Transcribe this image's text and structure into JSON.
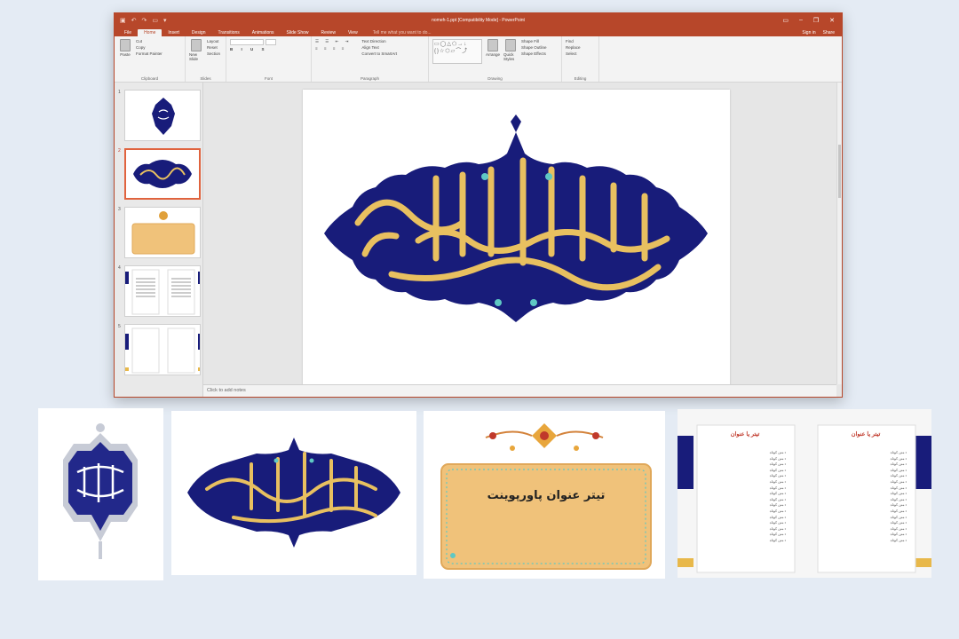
{
  "window": {
    "title": "nomeh-1.ppt [Compatibility Mode] - PowerPoint",
    "tabs": [
      "File",
      "Home",
      "Insert",
      "Design",
      "Transitions",
      "Animations",
      "Slide Show",
      "Review",
      "View"
    ],
    "active_tab": "Home",
    "tell_me": "Tell me what you want to do...",
    "sign_in": "Sign in",
    "share": "Share"
  },
  "ribbon": {
    "clipboard": {
      "label": "Clipboard",
      "paste": "Paste",
      "cut": "Cut",
      "copy": "Copy",
      "format_painter": "Format Painter"
    },
    "slides": {
      "label": "Slides",
      "new_slide": "New Slide",
      "layout": "Layout",
      "reset": "Reset",
      "section": "Section"
    },
    "font": {
      "label": "Font"
    },
    "paragraph": {
      "label": "Paragraph",
      "text_direction": "Text Direction",
      "align_text": "Align Text",
      "smartart": "Convert to SmartArt"
    },
    "drawing": {
      "label": "Drawing",
      "arrange": "Arrange",
      "quick_styles": "Quick Styles",
      "shape_fill": "Shape Fill",
      "shape_outline": "Shape Outline",
      "shape_effects": "Shape Effects"
    },
    "editing": {
      "label": "Editing",
      "find": "Find",
      "replace": "Replace",
      "select": "Select"
    }
  },
  "slides_panel": {
    "numbers": [
      "1",
      "2",
      "3",
      "4",
      "5"
    ]
  },
  "notes_placeholder": "Click to add notes",
  "slide3_title": "تیتر عنوان پاورپوینت",
  "preview_left_heading": "تیتر یا عنوان",
  "preview_right_heading": "تیتر یا عنوان",
  "bullet_text": "متن کوتاه",
  "colors": {
    "accent": "#b7472a",
    "navy": "#181c7a",
    "gold": "#e8c060",
    "box": "#f0c27a",
    "red_heading": "#c0392b"
  }
}
